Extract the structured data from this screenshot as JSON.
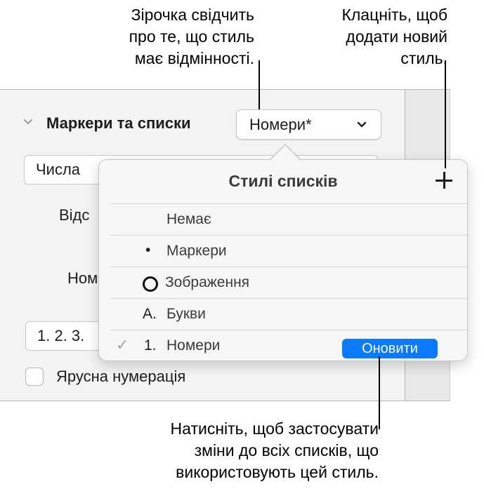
{
  "callouts": {
    "asterisk": [
      "Зірочка свідчить",
      "про те, що стиль",
      "має відмінності."
    ],
    "add_style": [
      "Клацніть, щоб",
      "додати новий",
      "стиль."
    ],
    "update": [
      "Натисніть, щоб застосувати",
      "зміни до всіх списків, що",
      "використовують цей стиль."
    ]
  },
  "inspector": {
    "section_title": "Маркери та списки",
    "style_popup": "Номери*",
    "numbers_field": "Числа",
    "indent_label": "Відс",
    "number_label": "Ном",
    "format_field": "1. 2. 3.",
    "tiered_label": "Ярусна нумерація"
  },
  "popover": {
    "title": "Стилі списків",
    "rows": [
      {
        "glyph": "",
        "label": "Немає"
      },
      {
        "glyph": "•",
        "label": "Маркери"
      },
      {
        "glyph": "ring",
        "label": "Зображення"
      },
      {
        "glyph": "A.",
        "label": "Букви"
      },
      {
        "glyph": "1.",
        "label": "Номери",
        "checked": "✓"
      }
    ],
    "update_button": "Оновити"
  },
  "colors": {
    "accent": "#0a7aff",
    "panel_bg": "#f3f3f3",
    "popover_bg": "#f6f6f6"
  }
}
